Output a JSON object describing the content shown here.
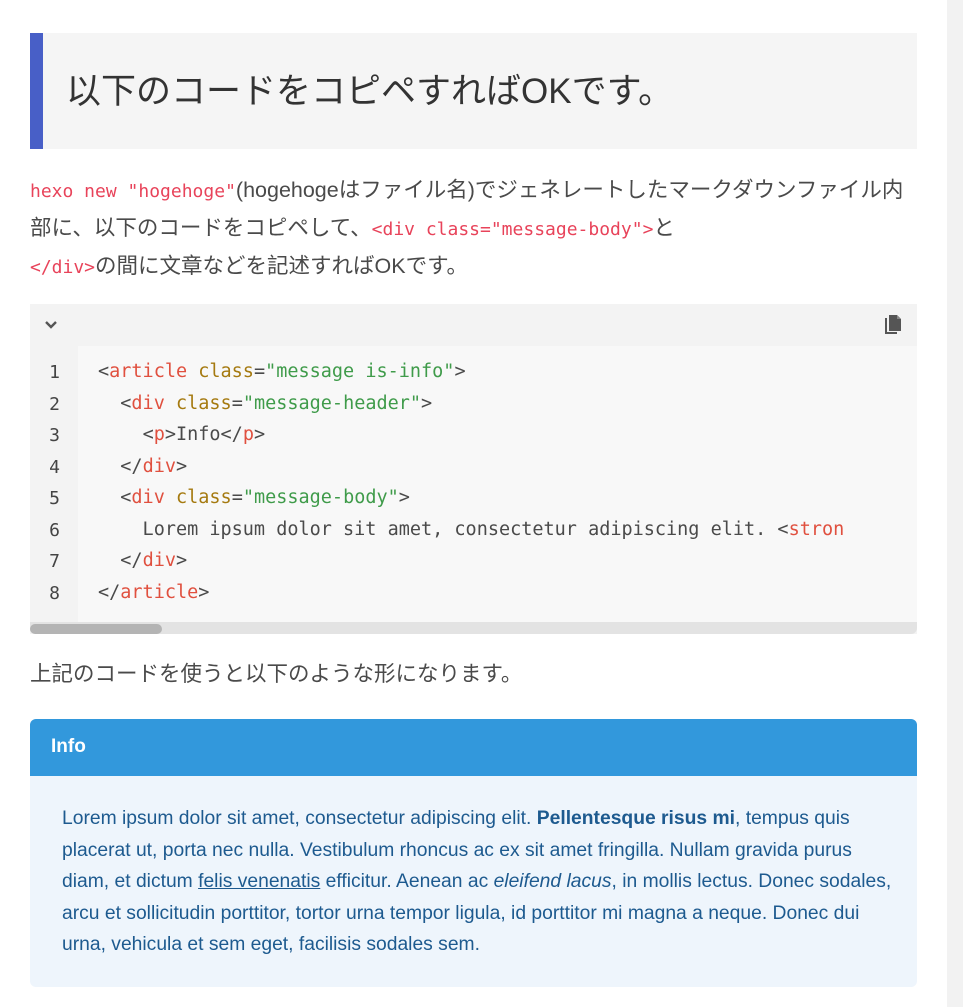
{
  "heading": "以下のコードをコピペすればOKです。",
  "intro": {
    "cmd": "hexo new \"hogehoge\"",
    "t1": "(hogehogeはファイル名)でジェネレートしたマークダウンファイル内部に、以下のコードをコピペして、",
    "code_open": "<div class=\"message-body\">",
    "t2": "と",
    "code_close": "</div>",
    "t3": "の間に文章などを記述すればOKです。"
  },
  "toolbar": {
    "collapse_icon": "chevron-down-icon",
    "copy_icon": "copy-icon"
  },
  "code": {
    "line_numbers": [
      "1",
      "2",
      "3",
      "4",
      "5",
      "6",
      "7",
      "8"
    ],
    "l1": {
      "p1": "<",
      "tag": "article",
      "p2": " ",
      "attr": "class",
      "eq": "=",
      "str": "\"message is-info\"",
      "end": ">"
    },
    "l2": {
      "indent": "  ",
      "p1": "<",
      "tag": "div",
      "p2": " ",
      "attr": "class",
      "eq": "=",
      "str": "\"message-header\"",
      "end": ">"
    },
    "l3": {
      "indent": "    ",
      "p1": "<",
      "tag1": "p",
      "mid": ">Info</",
      "tag2": "p",
      "end": ">"
    },
    "l4": {
      "indent": "  ",
      "p1": "</",
      "tag": "div",
      "end": ">"
    },
    "l5": {
      "indent": "  ",
      "p1": "<",
      "tag": "div",
      "p2": " ",
      "attr": "class",
      "eq": "=",
      "str": "\"message-body\"",
      "end": ">"
    },
    "l6": {
      "text": "    Lorem ipsum dolor sit amet, consectetur adipiscing elit. <",
      "tag": "stron"
    },
    "l7": {
      "indent": "  ",
      "p1": "</",
      "tag": "div",
      "end": ">"
    },
    "l8": {
      "p1": "</",
      "tag": "article",
      "end": ">"
    }
  },
  "caption": "上記のコードを使うと以下のような形になります。",
  "message": {
    "header": "Info",
    "body": {
      "t1": "Lorem ipsum dolor sit amet, consectetur adipiscing elit. ",
      "strong": "Pellentesque risus mi",
      "t2": ", tempus quis placerat ut, porta nec nulla. Vestibulum rhoncus ac ex sit amet fringilla. Nullam gravida purus diam, et dictum ",
      "link": "felis venenatis",
      "t3": " efficitur. Aenean ac ",
      "em": "eleifend lacus",
      "t4": ", in mollis lectus. Donec sodales, arcu et sollicitudin porttitor, tortor urna tempor ligula, id porttitor mi magna a neque. Donec dui urna, vehicula et sem eget, facilisis sodales sem."
    }
  }
}
